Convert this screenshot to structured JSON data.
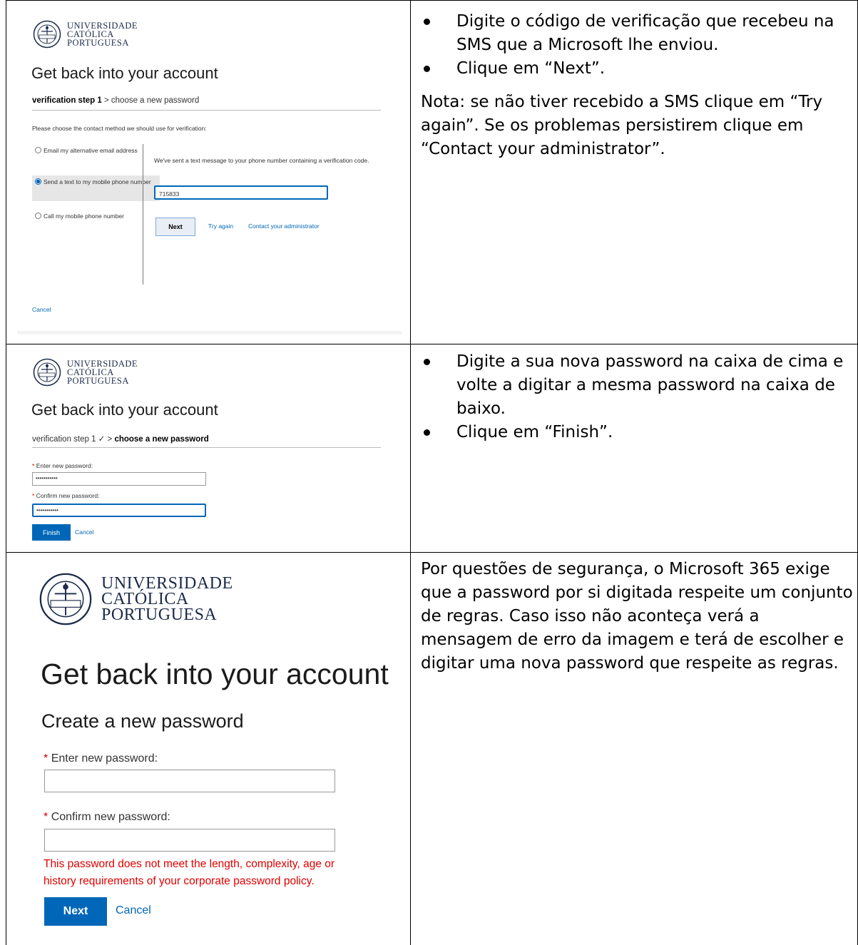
{
  "university": {
    "name_line1": "UNIVERSIDADE",
    "name_line2": "CATÓLICA",
    "name_line3": "PORTUGUESA"
  },
  "row1": {
    "heading": "Get back into your account",
    "step_bold": "verification step 1",
    "step_rest": " > choose a new password",
    "prompt": "Please choose the contact method we should use for verification:",
    "options": [
      {
        "label": "Email my alternative email address",
        "selected": false
      },
      {
        "label": "Send a text to my mobile phone number",
        "selected": true
      },
      {
        "label": "Call my mobile phone number",
        "selected": false
      }
    ],
    "sent_message": "We've sent a text message to your phone number containing a verification code.",
    "code_value": "715833",
    "next_label": "Next",
    "try_again_label": "Try again",
    "contact_admin_label": "Contact your administrator",
    "cancel_label": "Cancel",
    "instructions": [
      "Digite o código de verificação que recebeu na SMS que a Microsoft lhe enviou.",
      "Clique em “Next”."
    ],
    "note": "Nota: se não tiver recebido a SMS clique em “Try again”. Se os problemas persistirem clique em “Contact your administrator”."
  },
  "row2": {
    "heading": "Get back into your account",
    "step_rest": "verification step 1 ✓ > ",
    "step_bold": "choose a new password",
    "enter_label": "Enter new password:",
    "confirm_label": "Confirm new password:",
    "password_mask": "•••••••••••",
    "finish_label": "Finish",
    "cancel_label": "Cancel",
    "instructions": [
      "Digite a sua nova password na caixa de cima e volte a digitar a mesma password na caixa de baixo.",
      "Clique em “Finish”."
    ]
  },
  "row3": {
    "heading": "Get back into your account",
    "subheading": "Create a new password",
    "enter_label": "Enter new password:",
    "confirm_label": "Confirm new password:",
    "error": "This password does not meet the length, complexity, age or history requirements of your corporate password policy.",
    "next_label": "Next",
    "cancel_label": "Cancel",
    "description": "Por questões de segurança, o Microsoft 365 exige que a password por si digitada respeite um conjunto de regras. Caso isso não aconteça verá a mensagem de erro da imagem e terá de escolher e digitar uma nova password que respeite as regras."
  },
  "colors": {
    "link": "#0067b8",
    "primary_button": "#0067b8",
    "error": "#e00000"
  }
}
